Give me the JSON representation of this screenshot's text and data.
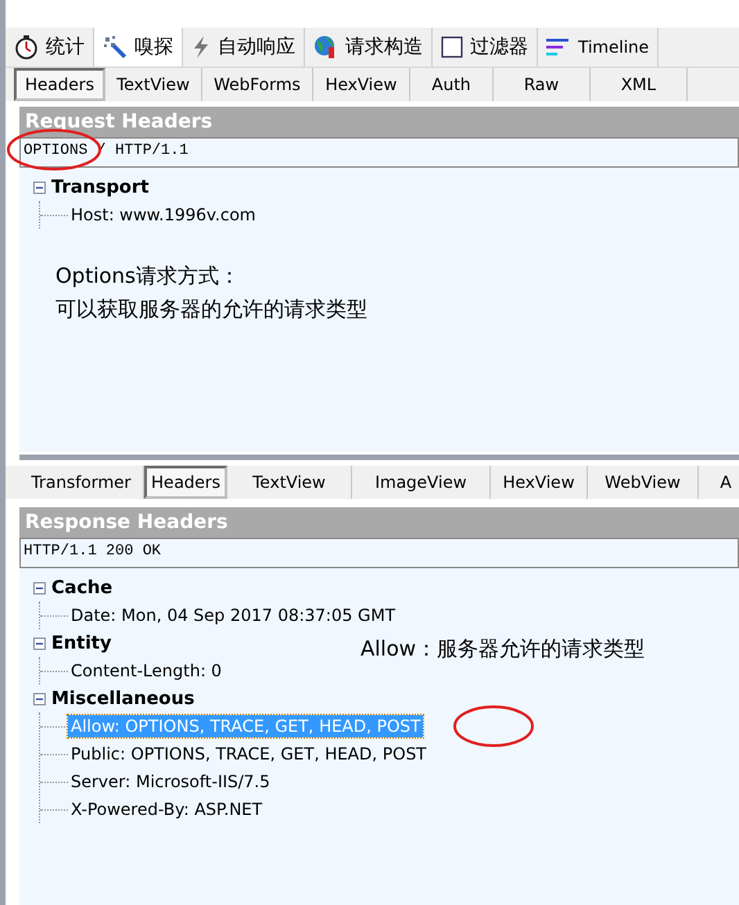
{
  "main_tabs": [
    {
      "label": "统计",
      "selected": false
    },
    {
      "label": "嗅探",
      "selected": true
    },
    {
      "label": "自动响应",
      "selected": false
    },
    {
      "label": "请求构造",
      "selected": false
    },
    {
      "label": "过滤器",
      "selected": false
    },
    {
      "label": "Timeline",
      "selected": false
    }
  ],
  "request": {
    "tabs": [
      {
        "label": "Headers",
        "selected": true
      },
      {
        "label": "TextView",
        "selected": false
      },
      {
        "label": "WebForms",
        "selected": false
      },
      {
        "label": "HexView",
        "selected": false
      },
      {
        "label": "Auth",
        "selected": false
      },
      {
        "label": "Raw",
        "selected": false
      },
      {
        "label": "XML",
        "selected": false
      }
    ],
    "title": "Request Headers",
    "first_line": "OPTIONS / HTTP/1.1",
    "groups": [
      {
        "name": "Transport",
        "expanded": true,
        "children": [
          {
            "text": "Host: www.1996v.com",
            "selected": false
          }
        ]
      }
    ],
    "note": [
      "Options请求方式：",
      "可以获取服务器的允许的请求类型"
    ]
  },
  "response": {
    "tabs": [
      {
        "label": "Transformer",
        "selected": false
      },
      {
        "label": "Headers",
        "selected": true
      },
      {
        "label": "TextView",
        "selected": false
      },
      {
        "label": "ImageView",
        "selected": false
      },
      {
        "label": "HexView",
        "selected": false
      },
      {
        "label": "WebView",
        "selected": false
      },
      {
        "label": "A",
        "selected": false
      }
    ],
    "title": "Response Headers",
    "first_line": "HTTP/1.1 200 OK",
    "groups": [
      {
        "name": "Cache",
        "expanded": true,
        "children": [
          {
            "text": "Date: Mon, 04 Sep 2017 08:37:05 GMT",
            "selected": false
          }
        ]
      },
      {
        "name": "Entity",
        "expanded": true,
        "children": [
          {
            "text": "Content-Length: 0",
            "selected": false
          }
        ]
      },
      {
        "name": "Miscellaneous",
        "expanded": true,
        "children": [
          {
            "text": "Allow: OPTIONS, TRACE, GET, HEAD, POST",
            "selected": true
          },
          {
            "text": "Public: OPTIONS, TRACE, GET, HEAD, POST",
            "selected": false
          },
          {
            "text": "Server: Microsoft-IIS/7.5",
            "selected": false
          },
          {
            "text": "X-Powered-By: ASP.NET",
            "selected": false
          }
        ]
      }
    ],
    "note": [
      "Allow：服务器允许的请求类型"
    ]
  }
}
